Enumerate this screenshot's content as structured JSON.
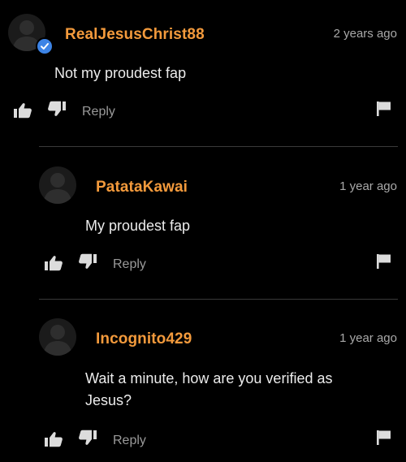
{
  "theme": {
    "background": "#000000",
    "username_color": "#f39a3c",
    "verified_badge_color": "#3d84e6",
    "text_color": "#ececec",
    "muted_color": "#9a9a9a",
    "divider_color": "#3a3a3a"
  },
  "icons": {
    "avatar": "user-silhouette-icon",
    "verified": "verified-check-icon",
    "like": "thumbs-up-icon",
    "dislike": "thumbs-down-icon",
    "flag": "flag-icon"
  },
  "comments": [
    {
      "username": "RealJesusChrist88",
      "verified": true,
      "timestamp": "2 years ago",
      "body": "Not my proudest fap",
      "reply_label": "Reply"
    },
    {
      "username": "PatataKawai",
      "verified": false,
      "timestamp": "1 year ago",
      "body": "My proudest fap",
      "reply_label": "Reply"
    },
    {
      "username": "Incognito429",
      "verified": false,
      "timestamp": "1 year ago",
      "body": "Wait a minute, how are you verified as Jesus?",
      "reply_label": "Reply"
    }
  ]
}
